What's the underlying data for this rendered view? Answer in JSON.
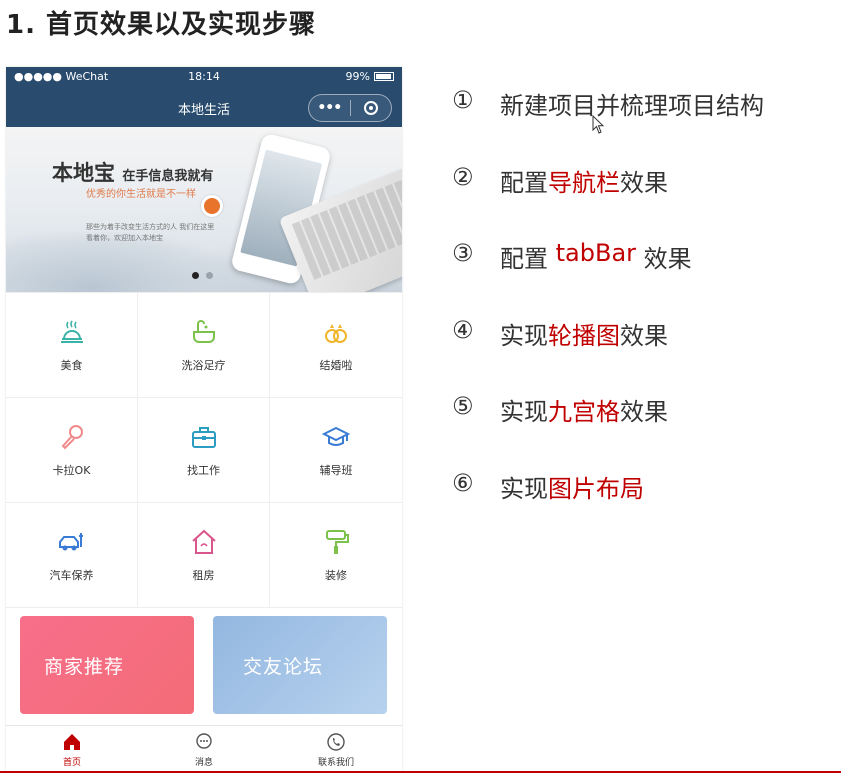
{
  "slide": {
    "title": "1. 首页效果以及实现步骤"
  },
  "phone": {
    "statusbar": {
      "signal": "●●●●● WeChat",
      "time": "18:14",
      "battery": "99%"
    },
    "navbar": {
      "title": "本地生活",
      "more_label": "•••",
      "color": "#284b6e"
    },
    "swiper": {
      "headline": "本地宝",
      "headline_tail": "在手信息我就有",
      "subline": "优秀的你生活就是不一样",
      "desc": "那些为着手改变生活方式的人 我们在这里看着你，欢迎加入本地宝"
    },
    "grid": [
      {
        "label": "美食",
        "icon": "food-icon"
      },
      {
        "label": "洗浴足疗",
        "icon": "bath-icon"
      },
      {
        "label": "结婚啦",
        "icon": "rings-icon"
      },
      {
        "label": "卡拉OK",
        "icon": "microphone-icon"
      },
      {
        "label": "找工作",
        "icon": "briefcase-icon"
      },
      {
        "label": "辅导班",
        "icon": "graduation-cap-icon"
      },
      {
        "label": "汽车保养",
        "icon": "car-icon"
      },
      {
        "label": "租房",
        "icon": "house-icon"
      },
      {
        "label": "装修",
        "icon": "paint-roller-icon"
      }
    ],
    "cards": {
      "merchant": "商家推荐",
      "forum": "交友论坛"
    },
    "tabbar": [
      {
        "label": "首页",
        "icon": "home-icon",
        "active": true
      },
      {
        "label": "消息",
        "icon": "message-icon",
        "active": false
      },
      {
        "label": "联系我们",
        "icon": "phone-icon",
        "active": false
      }
    ]
  },
  "steps": [
    {
      "num": "①",
      "pre": "新建项目并梳理项目结构",
      "hl": "",
      "post": ""
    },
    {
      "num": "②",
      "pre": "配置",
      "hl": "导航栏",
      "post": "效果"
    },
    {
      "num": "③",
      "pre": "配置 ",
      "hl": "tabBar",
      "post": " 效果"
    },
    {
      "num": "④",
      "pre": "实现",
      "hl": "轮播图",
      "post": "效果"
    },
    {
      "num": "⑤",
      "pre": "实现",
      "hl": "九宫格",
      "post": "效果"
    },
    {
      "num": "⑥",
      "pre": "实现",
      "hl": "图片布局",
      "post": ""
    }
  ],
  "colors": {
    "accent": "#c00000",
    "text": "#333333"
  }
}
